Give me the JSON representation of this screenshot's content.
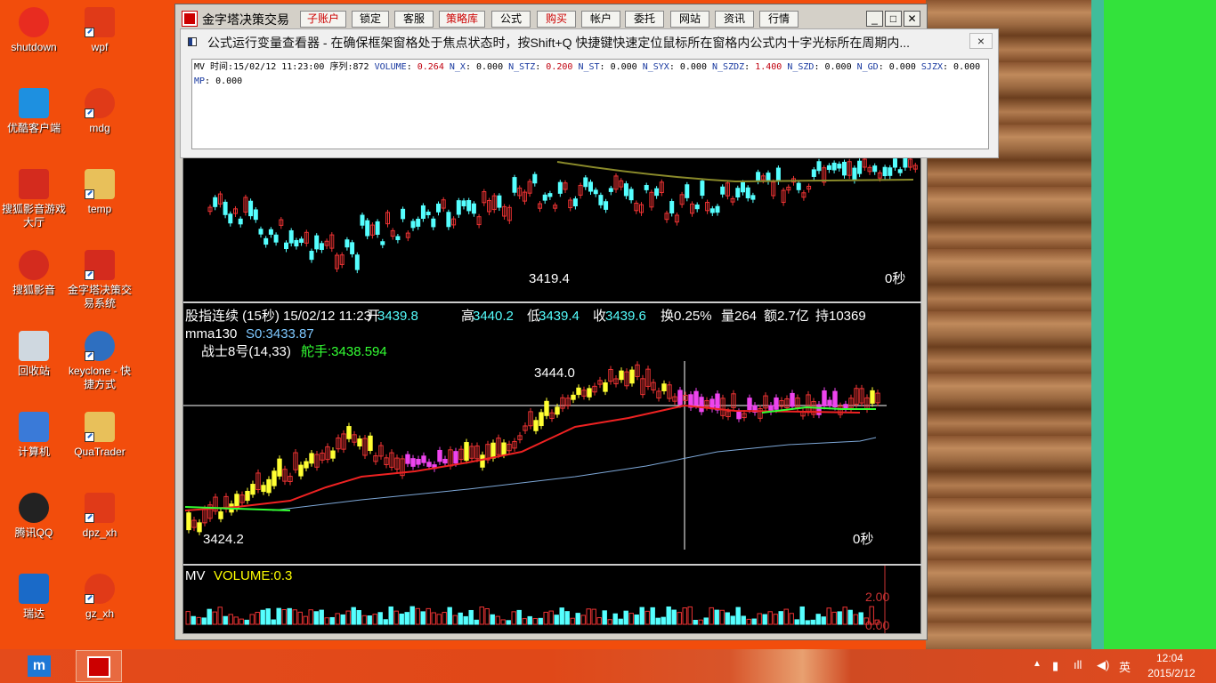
{
  "desktop": {
    "icons": [
      {
        "label": "shutdown",
        "color": "#e82c20"
      },
      {
        "label": "wpf",
        "color": "#e03a18"
      },
      {
        "label": "优酷客户端",
        "color": "#1e90e0"
      },
      {
        "label": "mdg",
        "color": "#e03a18"
      },
      {
        "label": "搜狐影音游戏大厅",
        "color": "#d42b1e"
      },
      {
        "label": "temp",
        "color": "#e8c05a"
      },
      {
        "label": "搜狐影音",
        "color": "#d42b1e"
      },
      {
        "label": "金字塔决策交易系统",
        "color": "#d42b1e"
      },
      {
        "label": "回收站",
        "color": "#cfd8e0"
      },
      {
        "label": "keyclone - 快捷方式",
        "color": "#2e6fc0"
      },
      {
        "label": "计算机",
        "color": "#3a7ad8"
      },
      {
        "label": "QuaTrader",
        "color": "#e8c05a"
      },
      {
        "label": "腾讯QQ",
        "color": "#222"
      },
      {
        "label": "dpz_xh",
        "color": "#e03a18"
      },
      {
        "label": "瑞达",
        "color": "#1a6ac8"
      },
      {
        "label": "gz_xh",
        "color": "#e03a18"
      }
    ]
  },
  "window": {
    "title": "金字塔决策交易",
    "menu": [
      "子账户",
      "锁定",
      "客服",
      "策略库",
      "公式",
      "购买",
      "帐户",
      "委托",
      "网站",
      "资讯",
      "行情"
    ],
    "menu_colors": [
      "#c00",
      "#000",
      "#000",
      "#c00",
      "#000",
      "#c00",
      "#000",
      "#000",
      "#000",
      "#000",
      "#000"
    ]
  },
  "popup": {
    "title": "公式运行变量查看器 - 在确保框架窗格处于焦点状态时，按Shift+Q 快捷键快速定位鼠标所在窗格内公式内十字光标所在周期内...",
    "close": "×",
    "head": "MV 时间:15/02/12 11:23:00 序列:872",
    "vars": [
      [
        "VOLUME",
        "0.264"
      ],
      [
        "N_X",
        "0.000"
      ],
      [
        "N_STZ",
        "0.200"
      ],
      [
        "N_ST",
        "0.000"
      ],
      [
        "N_SYX",
        "0.000"
      ],
      [
        "N_SZDZ",
        "1.400"
      ],
      [
        "N_SZD",
        "0.000"
      ],
      [
        "N_GD",
        "0.000"
      ],
      [
        "SJZX",
        "0.000"
      ],
      [
        "MP",
        "0.000"
      ]
    ]
  },
  "top_chart": {
    "low_label": "3419.4",
    "secs": "0秒"
  },
  "main_chart": {
    "title": "股指连续 (15秒) 15/02/12 11:23",
    "open_l": "开",
    "open": "3439.8",
    "high_l": "高",
    "high": "3440.2",
    "low_l": "低",
    "low": "3439.4",
    "close_l": "收",
    "close": "3439.6",
    "turn": "换0.25%",
    "vol": "量264",
    "amt": "额2.7亿",
    "hold": "持10369",
    "mma": "mma130",
    "s0": "S0:3433.87",
    "fighter": "战士8号(14,33)",
    "helm": "舵手:3438.594",
    "hi_label": "3444.0",
    "lo_label": "3424.2",
    "secs": "0秒"
  },
  "vol_chart": {
    "name": "MV",
    "vol": "VOLUME:0.3",
    "tick_hi": "2.00",
    "tick_lo": "0.00"
  },
  "taskbar": {
    "lang": "英",
    "time": "12:04",
    "date": "2015/2/12"
  }
}
